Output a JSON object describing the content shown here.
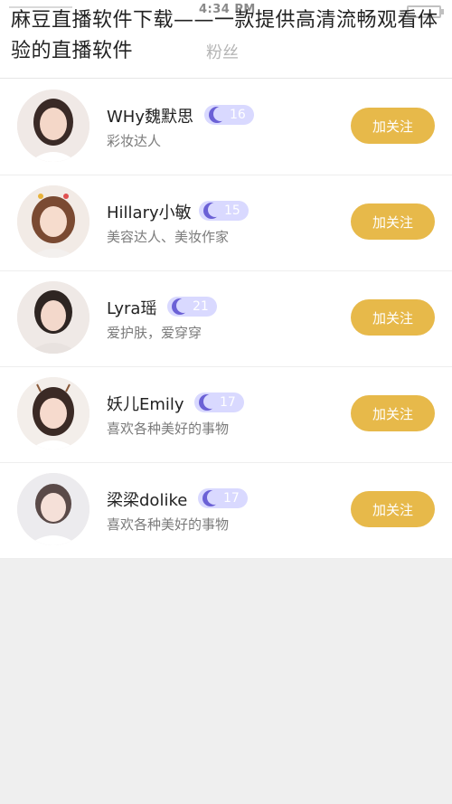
{
  "status_bar": {
    "time": "4:34 PM"
  },
  "overlay_title": "麻豆直播软件下载——一款提供高清流畅观看体验的直播软件",
  "nav": {
    "faint_label": "粉丝"
  },
  "follow_label": "加关注",
  "colors": {
    "accent": "#e7b94a",
    "badge_bg": "#d9d9ff",
    "badge_moon": "#6b61d6"
  },
  "users": [
    {
      "name": "WHy魏默思",
      "level": "16",
      "desc": "彩妆达人",
      "avatar_icon": "user-avatar"
    },
    {
      "name": "Hillary小敏",
      "level": "15",
      "desc": "美容达人、美妆作家",
      "avatar_icon": "user-avatar"
    },
    {
      "name": "Lyra瑶",
      "level": "21",
      "desc": "爱护肤，爱穿穿",
      "avatar_icon": "user-avatar"
    },
    {
      "name": "妖儿Emily",
      "level": "17",
      "desc": "喜欢各种美好的事物",
      "avatar_icon": "user-avatar"
    },
    {
      "name": "梁梁dolike",
      "level": "17",
      "desc": "喜欢各种美好的事物",
      "avatar_icon": "user-avatar"
    }
  ]
}
